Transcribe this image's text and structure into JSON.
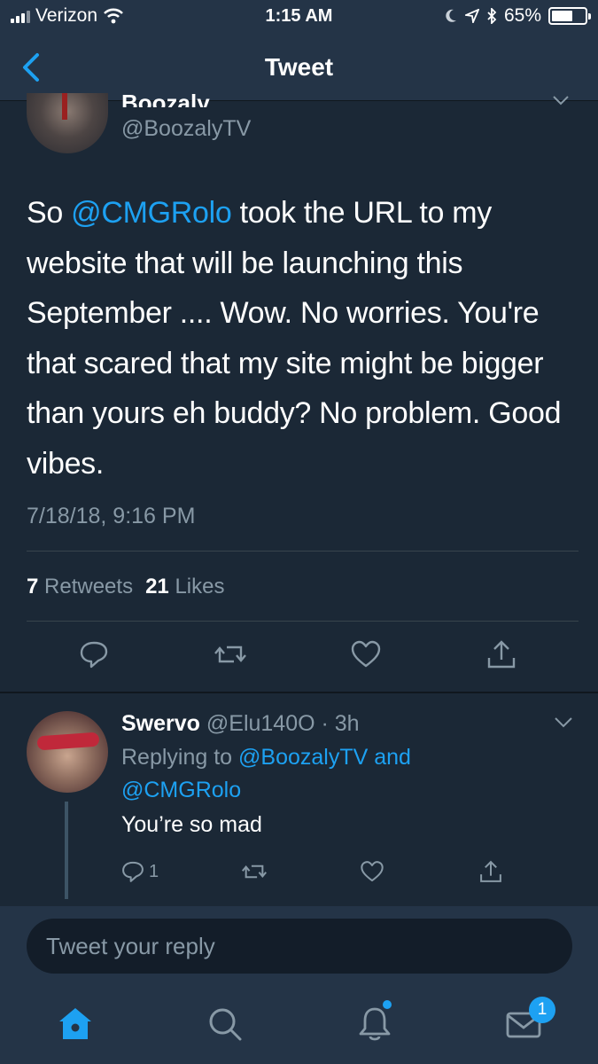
{
  "status_bar": {
    "carrier": "Verizon",
    "time": "1:15 AM",
    "battery": "65%",
    "battery_level": 0.65,
    "icons": [
      "signal-icon",
      "wifi-icon",
      "moon-icon",
      "location-icon",
      "bluetooth-icon",
      "battery-icon"
    ]
  },
  "nav": {
    "title": "Tweet",
    "back_icon": "chevron-left-icon"
  },
  "tweet": {
    "author_name": "Boozaly",
    "author_handle": "@BoozalyTV",
    "text_before": "So ",
    "mention": "@CMGRolo",
    "text_after": " took the URL to my website that will be launching this September .... Wow. No worries. You're that scared that my site might be bigger than yours eh buddy? No problem. Good vibes.",
    "timestamp": "7/18/18, 9:16 PM",
    "retweets_count": "7",
    "retweets_label": "Retweets",
    "likes_count": "21",
    "likes_label": "Likes",
    "actions": [
      "reply-icon",
      "retweet-icon",
      "like-icon",
      "share-icon"
    ]
  },
  "reply": {
    "name": "Swervo",
    "handle": "@Elu140O",
    "time": "3h",
    "replying_prefix": "Replying to ",
    "replying_to_1": "@BoozalyTV",
    "replying_and": " and",
    "replying_to_2": "@CMGRolo",
    "text": "You’re so mad",
    "reply_count": "1"
  },
  "composer": {
    "placeholder": "Tweet your reply"
  },
  "tab_bar": {
    "tabs": [
      "home-icon",
      "search-icon",
      "notifications-icon",
      "messages-icon"
    ],
    "messages_badge": "1"
  },
  "colors": {
    "background": "#1b2836",
    "bar": "#243447",
    "accent": "#1da1f2",
    "secondary_text": "#8899a6"
  }
}
